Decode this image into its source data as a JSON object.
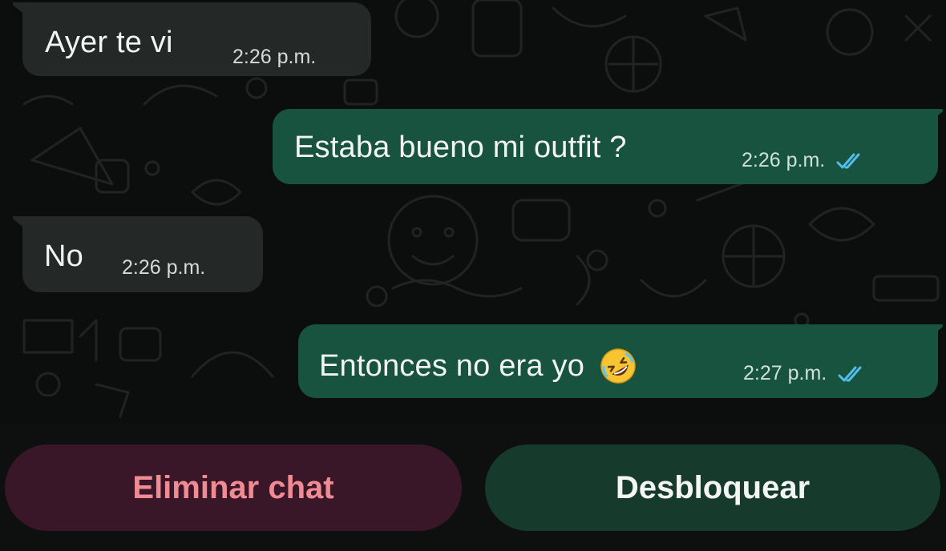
{
  "messages": [
    {
      "direction": "incoming",
      "text": "Ayer te vi",
      "time": "2:26 p.m."
    },
    {
      "direction": "outgoing",
      "text": "Estaba bueno mi outfit ?",
      "time": "2:26 p.m.",
      "status": "read"
    },
    {
      "direction": "incoming",
      "text": "No",
      "time": "2:26 p.m."
    },
    {
      "direction": "outgoing",
      "text": "Entonces no era yo",
      "emoji": "rolling-on-floor-laughing",
      "time": "2:27 p.m.",
      "status": "read"
    }
  ],
  "actions": {
    "delete_label": "Eliminar chat",
    "unblock_label": "Desbloquear"
  },
  "colors": {
    "incoming_bubble": "#242826",
    "outgoing_bubble": "#17533f",
    "read_ticks": "#53bdeb",
    "delete_text": "#f08a93",
    "delete_bg": "#3a1728",
    "unblock_bg": "#163a2c"
  }
}
